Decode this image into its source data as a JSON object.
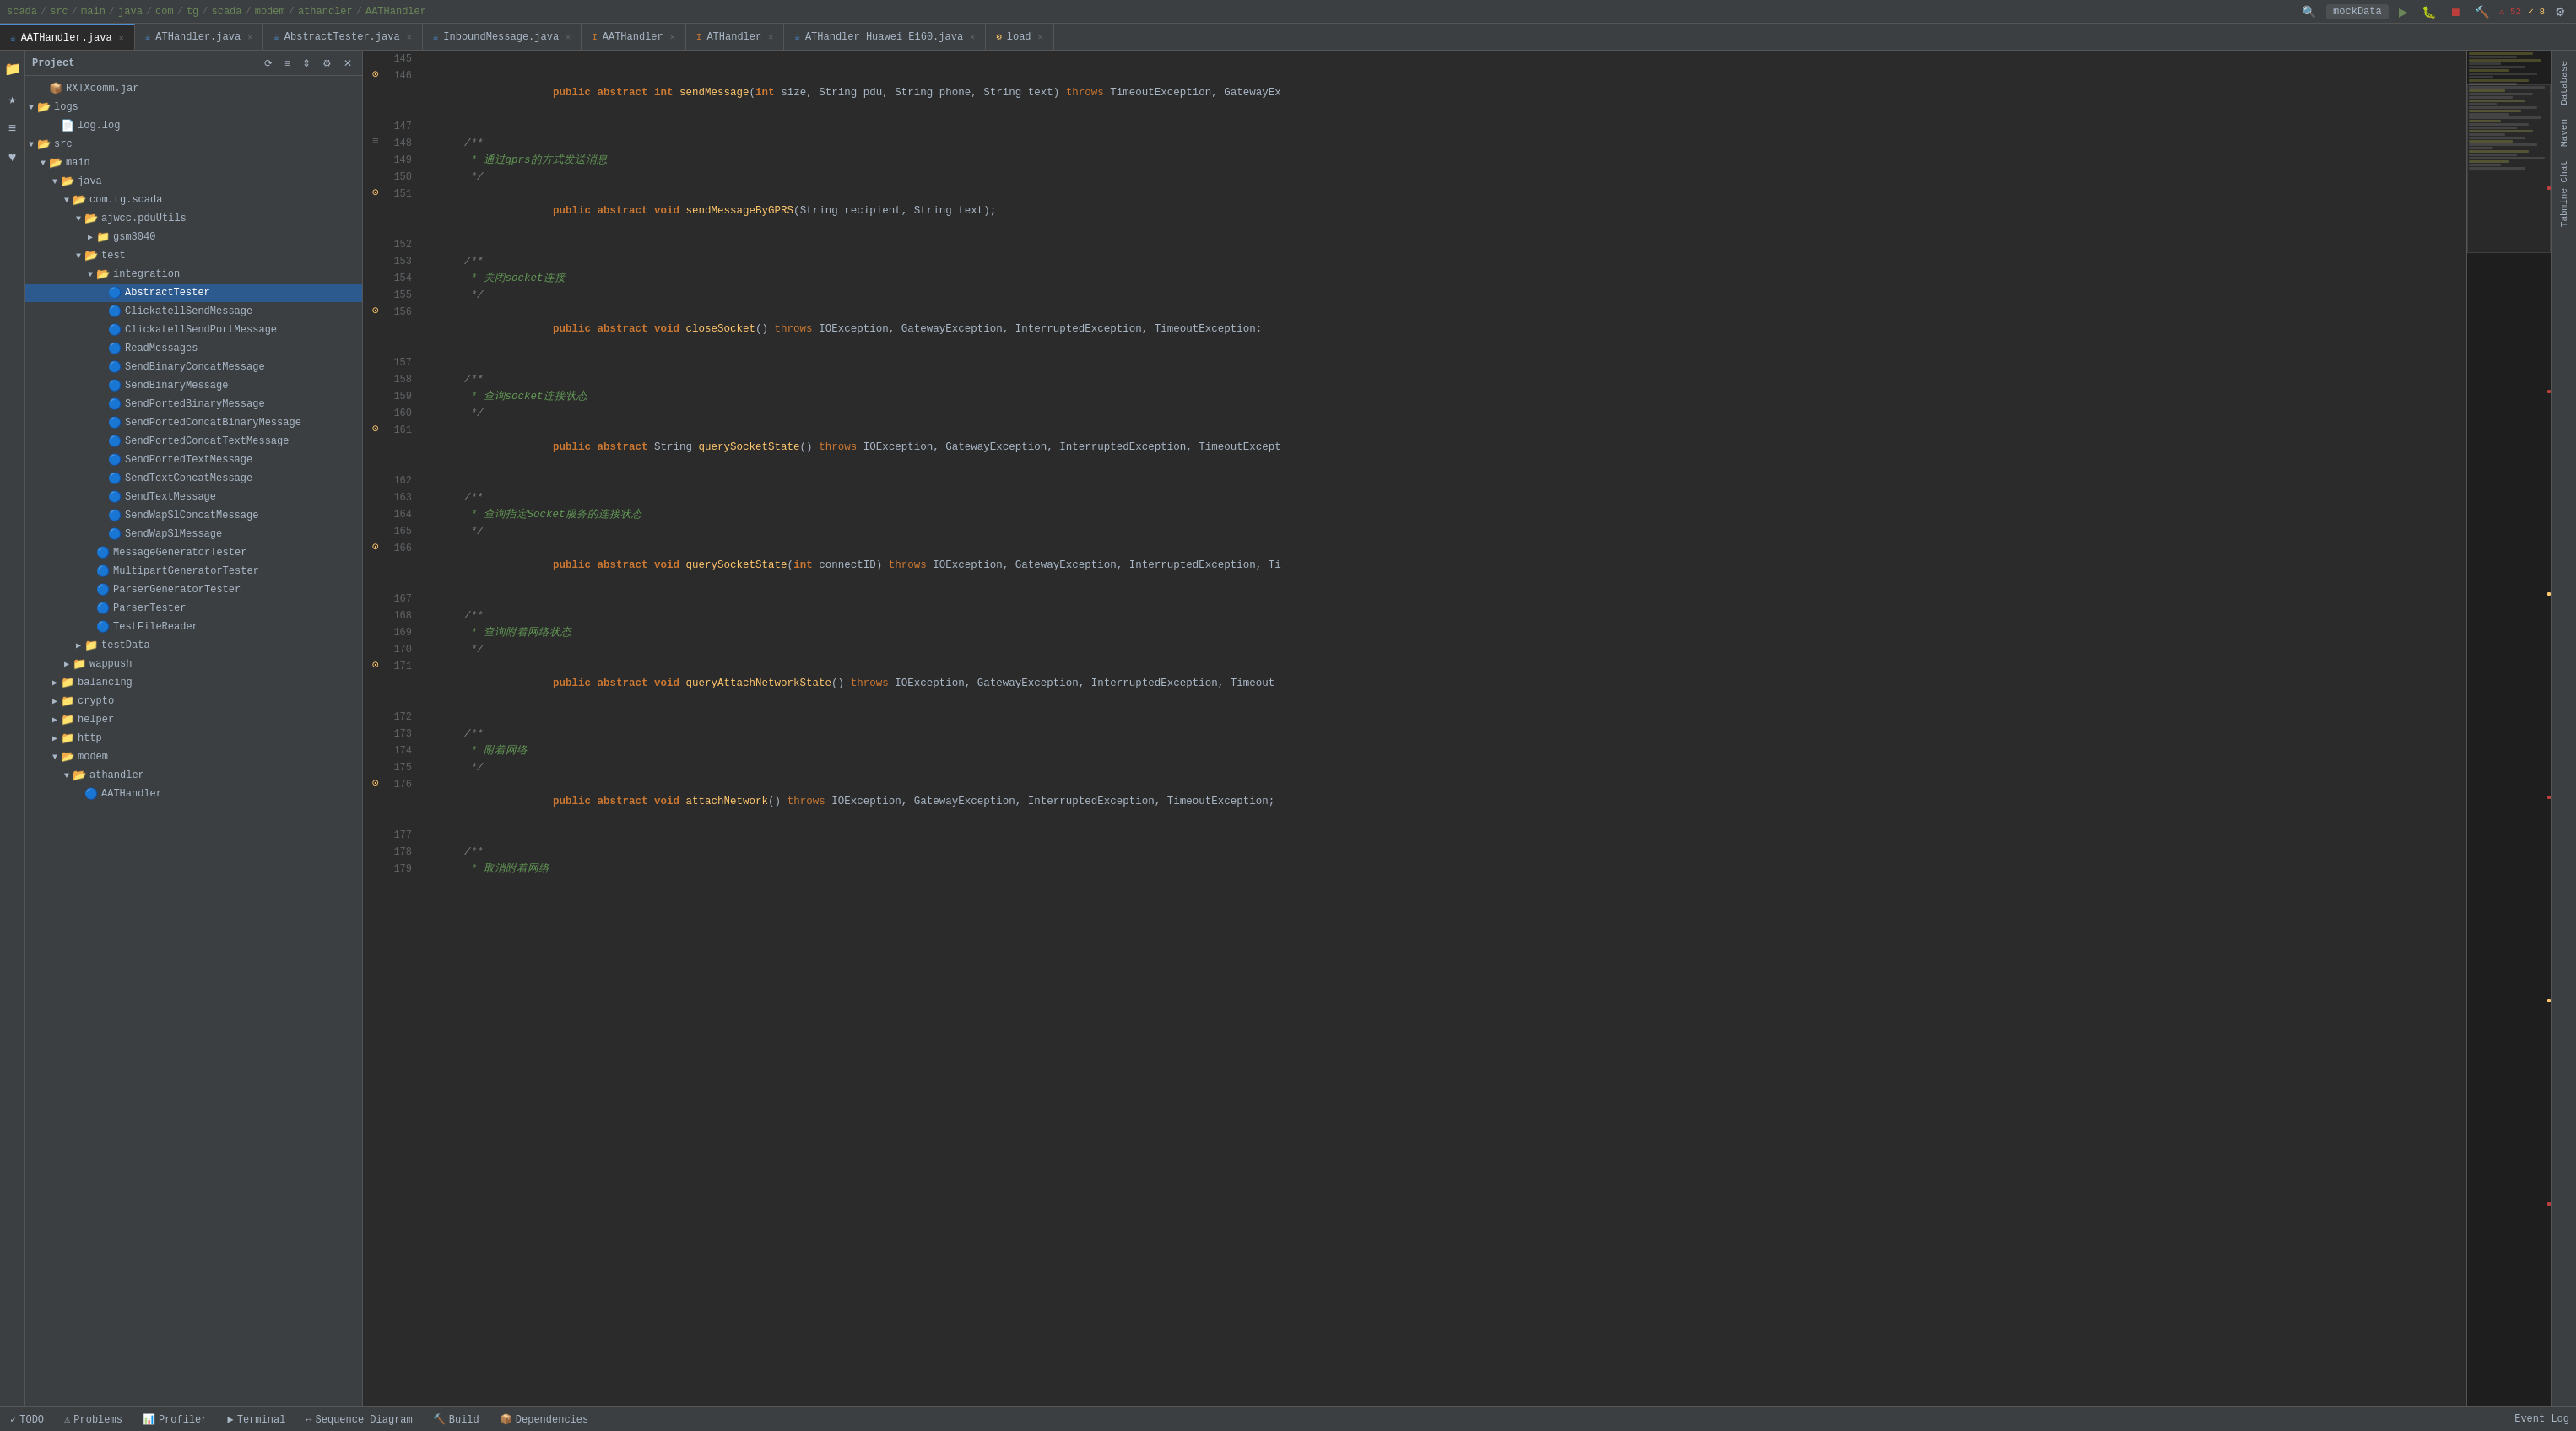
{
  "topbar": {
    "breadcrumb": [
      "scada",
      "src",
      "main",
      "java",
      "com",
      "tg",
      "scada",
      "modem",
      "athandler",
      "AATHandler"
    ],
    "run_dropdown": "mockData",
    "warnings_count": "52",
    "errors_count": "8"
  },
  "tabs": [
    {
      "id": "aathandler-java",
      "label": "AATHandler.java",
      "active": true,
      "type": "java"
    },
    {
      "id": "athandler-java",
      "label": "ATHandler.java",
      "active": false,
      "type": "java"
    },
    {
      "id": "abstracttester-java",
      "label": "AbstractTester.java",
      "active": false,
      "type": "java"
    },
    {
      "id": "inboundmessage-java",
      "label": "InboundMessage.java",
      "active": false,
      "type": "java"
    },
    {
      "id": "aathandler-iface",
      "label": "AATHandler",
      "active": false,
      "type": "interface"
    },
    {
      "id": "athandler-iface",
      "label": "ATHandler",
      "active": false,
      "type": "interface"
    },
    {
      "id": "athandler-huawei",
      "label": "ATHandler_Huawei_E160.java",
      "active": false,
      "type": "java"
    },
    {
      "id": "load",
      "label": "load",
      "active": false,
      "type": "other"
    }
  ],
  "sidebar": {
    "title": "Project",
    "tree": [
      {
        "id": "rxtxcomm",
        "label": "RXTXcomm.jar",
        "indent": 1,
        "type": "jar",
        "arrow": ""
      },
      {
        "id": "logs",
        "label": "logs",
        "indent": 0,
        "type": "folder",
        "arrow": "▼",
        "open": true
      },
      {
        "id": "log-log",
        "label": "log.log",
        "indent": 2,
        "type": "file",
        "arrow": ""
      },
      {
        "id": "src",
        "label": "src",
        "indent": 0,
        "type": "folder",
        "arrow": "▼",
        "open": true
      },
      {
        "id": "main",
        "label": "main",
        "indent": 1,
        "type": "folder",
        "arrow": "▼",
        "open": true
      },
      {
        "id": "java",
        "label": "java",
        "indent": 2,
        "type": "folder",
        "arrow": "▼",
        "open": true
      },
      {
        "id": "com-tg-scada",
        "label": "com.tg.scada",
        "indent": 3,
        "type": "folder",
        "arrow": "▼",
        "open": true
      },
      {
        "id": "ajwcc-pduutils",
        "label": "ajwcc.pduUtils",
        "indent": 4,
        "type": "folder",
        "arrow": "▼",
        "open": true
      },
      {
        "id": "gsm3040",
        "label": "gsm3040",
        "indent": 5,
        "type": "folder",
        "arrow": "▶",
        "open": false
      },
      {
        "id": "test",
        "label": "test",
        "indent": 4,
        "type": "folder",
        "arrow": "▼",
        "open": true
      },
      {
        "id": "integration",
        "label": "integration",
        "indent": 5,
        "type": "folder",
        "arrow": "▼",
        "open": true
      },
      {
        "id": "abstracttester",
        "label": "AbstractTester",
        "indent": 6,
        "type": "class",
        "arrow": "",
        "selected": true
      },
      {
        "id": "clickatellsendmessage",
        "label": "ClickatellSendMessage",
        "indent": 6,
        "type": "class",
        "arrow": ""
      },
      {
        "id": "clickatellsendportmessage",
        "label": "ClickatellSendPortMessage",
        "indent": 6,
        "type": "class",
        "arrow": ""
      },
      {
        "id": "readmessages",
        "label": "ReadMessages",
        "indent": 6,
        "type": "class",
        "arrow": ""
      },
      {
        "id": "sendbinaryconcatmessage",
        "label": "SendBinaryConcatMessage",
        "indent": 6,
        "type": "class",
        "arrow": ""
      },
      {
        "id": "sendbinarymessage",
        "label": "SendBinaryMessage",
        "indent": 6,
        "type": "class",
        "arrow": ""
      },
      {
        "id": "sendportedbinarymessage",
        "label": "SendPortedBinaryMessage",
        "indent": 6,
        "type": "class",
        "arrow": ""
      },
      {
        "id": "sendportedconcatbinarymessage",
        "label": "SendPortedConcatBinaryMessage",
        "indent": 6,
        "type": "class",
        "arrow": ""
      },
      {
        "id": "sendportedconcattextmessage",
        "label": "SendPortedConcatTextMessage",
        "indent": 6,
        "type": "class",
        "arrow": ""
      },
      {
        "id": "sendportedtextmessage",
        "label": "SendPortedTextMessage",
        "indent": 6,
        "type": "class",
        "arrow": ""
      },
      {
        "id": "sendtextconcatmessage",
        "label": "SendTextConcatMessage",
        "indent": 6,
        "type": "class",
        "arrow": ""
      },
      {
        "id": "sendtextmessage",
        "label": "SendTextMessage",
        "indent": 6,
        "type": "class",
        "arrow": ""
      },
      {
        "id": "sendwapslconcatmessage",
        "label": "SendWapSlConcatMessage",
        "indent": 6,
        "type": "class",
        "arrow": ""
      },
      {
        "id": "sendwapslmessage",
        "label": "SendWapSlMessage",
        "indent": 6,
        "type": "class",
        "arrow": ""
      },
      {
        "id": "messagegeneratortester",
        "label": "MessageGeneratorTester",
        "indent": 5,
        "type": "class",
        "arrow": ""
      },
      {
        "id": "multipartgeneratortester",
        "label": "MultipartGeneratorTester",
        "indent": 5,
        "type": "class",
        "arrow": ""
      },
      {
        "id": "parsergeneratortester",
        "label": "ParserGeneratorTester",
        "indent": 5,
        "type": "class",
        "arrow": ""
      },
      {
        "id": "parsertester",
        "label": "ParserTester",
        "indent": 5,
        "type": "class",
        "arrow": ""
      },
      {
        "id": "testfilereader",
        "label": "TestFileReader",
        "indent": 5,
        "type": "class",
        "arrow": ""
      },
      {
        "id": "testdata",
        "label": "testData",
        "indent": 4,
        "type": "folder",
        "arrow": "▶",
        "open": false
      },
      {
        "id": "wappush",
        "label": "wappush",
        "indent": 3,
        "type": "folder",
        "arrow": "▶",
        "open": false
      },
      {
        "id": "balancing",
        "label": "balancing",
        "indent": 2,
        "type": "folder",
        "arrow": "▶",
        "open": false
      },
      {
        "id": "crypto",
        "label": "crypto",
        "indent": 2,
        "type": "folder",
        "arrow": "▶",
        "open": false
      },
      {
        "id": "helper",
        "label": "helper",
        "indent": 2,
        "type": "folder",
        "arrow": "▶",
        "open": false
      },
      {
        "id": "http",
        "label": "http",
        "indent": 2,
        "type": "folder",
        "arrow": "▶",
        "open": false
      },
      {
        "id": "modem",
        "label": "modem",
        "indent": 2,
        "type": "folder",
        "arrow": "▼",
        "open": true
      },
      {
        "id": "athandler-folder",
        "label": "athandler",
        "indent": 3,
        "type": "folder",
        "arrow": "▼",
        "open": true
      },
      {
        "id": "aathandler-class",
        "label": "AATHandler",
        "indent": 4,
        "type": "class",
        "arrow": ""
      }
    ]
  },
  "code": {
    "lines": [
      {
        "num": 145,
        "gutter": "",
        "content": ""
      },
      {
        "num": 146,
        "gutter": "⊙",
        "content": "    public abstract int sendMessage(int size, String pdu, String phone, String text) throws TimeoutException, GatewayEx"
      },
      {
        "num": 147,
        "gutter": "",
        "content": ""
      },
      {
        "num": 148,
        "gutter": "≡",
        "content": "    /**"
      },
      {
        "num": 149,
        "gutter": "",
        "content": "     * 通过gprs的方式发送消息"
      },
      {
        "num": 150,
        "gutter": "",
        "content": "     */"
      },
      {
        "num": 151,
        "gutter": "⊙",
        "content": "    public abstract void sendMessageByGPRS(String recipient, String text);"
      },
      {
        "num": 152,
        "gutter": "",
        "content": ""
      },
      {
        "num": 153,
        "gutter": "",
        "content": "    /**"
      },
      {
        "num": 154,
        "gutter": "",
        "content": "     * 关闭socket连接"
      },
      {
        "num": 155,
        "gutter": "",
        "content": "     */"
      },
      {
        "num": 156,
        "gutter": "⊙",
        "content": "    public abstract void closeSocket() throws IOException, GatewayException, InterruptedException, TimeoutException;"
      },
      {
        "num": 157,
        "gutter": "",
        "content": ""
      },
      {
        "num": 158,
        "gutter": "",
        "content": "    /**"
      },
      {
        "num": 159,
        "gutter": "",
        "content": "     * 查询socket连接状态"
      },
      {
        "num": 160,
        "gutter": "",
        "content": "     */"
      },
      {
        "num": 161,
        "gutter": "⊙",
        "content": "    public abstract String querySocketState() throws IOException, GatewayException, InterruptedException, TimeoutExcept"
      },
      {
        "num": 162,
        "gutter": "",
        "content": ""
      },
      {
        "num": 163,
        "gutter": "",
        "content": "    /**"
      },
      {
        "num": 164,
        "gutter": "",
        "content": "     * 查询指定Socket服务的连接状态"
      },
      {
        "num": 165,
        "gutter": "",
        "content": "     */"
      },
      {
        "num": 166,
        "gutter": "⊙",
        "content": "    public abstract void querySocketState(int connectID) throws IOException, GatewayException, InterruptedException, Ti"
      },
      {
        "num": 167,
        "gutter": "",
        "content": ""
      },
      {
        "num": 168,
        "gutter": "",
        "content": "    /**"
      },
      {
        "num": 169,
        "gutter": "",
        "content": "     * 查询附着网络状态"
      },
      {
        "num": 170,
        "gutter": "",
        "content": "     */"
      },
      {
        "num": 171,
        "gutter": "⊙",
        "content": "    public abstract void queryAttachNetworkState() throws IOException, GatewayException, InterruptedException, Timeout"
      },
      {
        "num": 172,
        "gutter": "",
        "content": ""
      },
      {
        "num": 173,
        "gutter": "",
        "content": "    /**"
      },
      {
        "num": 174,
        "gutter": "",
        "content": "     * 附着网络"
      },
      {
        "num": 175,
        "gutter": "",
        "content": "     */"
      },
      {
        "num": 176,
        "gutter": "⊙",
        "content": "    public abstract void attachNetwork() throws IOException, GatewayException, InterruptedException, TimeoutException;"
      },
      {
        "num": 177,
        "gutter": "",
        "content": ""
      },
      {
        "num": 178,
        "gutter": "",
        "content": "    /**"
      },
      {
        "num": 179,
        "gutter": "",
        "content": "     * 取消附着网络"
      }
    ]
  },
  "bottom_tabs": [
    {
      "label": "TODO",
      "icon": "✓",
      "active": false
    },
    {
      "label": "Problems",
      "icon": "⚠",
      "active": false
    },
    {
      "label": "Profiler",
      "icon": "📊",
      "active": false
    },
    {
      "label": "Terminal",
      "icon": "▶",
      "active": false
    },
    {
      "label": "Sequence Diagram",
      "icon": "↔",
      "active": false
    },
    {
      "label": "Build",
      "icon": "🔨",
      "active": false
    },
    {
      "label": "Dependencies",
      "icon": "📦",
      "active": false
    }
  ],
  "status_bar": {
    "right_text": "Event Log"
  },
  "right_panels": [
    {
      "label": "Database"
    },
    {
      "label": "Maven"
    },
    {
      "label": "Tabmine Chat"
    }
  ]
}
